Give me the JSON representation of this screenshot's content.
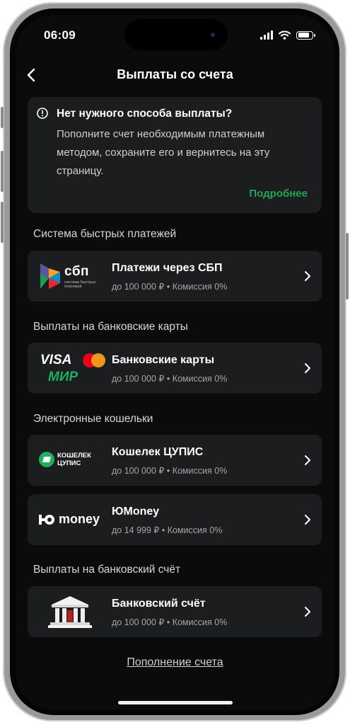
{
  "status": {
    "time": "06:09"
  },
  "header": {
    "title": "Выплаты со счета",
    "back_icon": "chevron-left-icon"
  },
  "notice": {
    "title": "Нет нужного способа выплаты?",
    "text": "Пополните счет необходимым платежным методом, сохраните его и вернитесь на эту страницу.",
    "link": "Подробнее",
    "link_color": "#22a453"
  },
  "sections": [
    {
      "title": "Система быстрых платежей"
    },
    {
      "title": "Выплаты на банковские карты"
    },
    {
      "title": "Электронные кошельки"
    },
    {
      "title": "Выплаты на банковский счёт"
    }
  ],
  "methods": {
    "sbp": {
      "title": "Платежи через СБП",
      "limit": "до 100 000 ₽",
      "fee": "Комиссия 0%",
      "logo_text": "сбп",
      "logo_caption": "система быстрых платежей"
    },
    "cards": {
      "title": "Банковские карты",
      "limit": "до 100 000 ₽",
      "fee": "Комиссия 0%",
      "logo_visa": "VISA",
      "logo_mir": "МИР"
    },
    "cupis": {
      "title": "Кошелек ЦУПИС",
      "limit": "до 100 000 ₽",
      "fee": "Комиссия 0%",
      "logo_line1": "КОШЕЛЕК",
      "logo_line2": "ЦУПИС"
    },
    "yoomoney": {
      "title": "ЮMoney",
      "limit": "до 14 999 ₽",
      "fee": "Комиссия 0%",
      "logo_text": "money"
    },
    "bank": {
      "title": "Банковский счёт",
      "limit": "до 100 000 ₽",
      "fee": "Комиссия 0%"
    }
  },
  "footer": {
    "link": "Пополнение счета"
  },
  "separator": "•",
  "colors": {
    "background": "#0b0b0c",
    "card": "#1c1d1f",
    "accent_green": "#22a453"
  }
}
